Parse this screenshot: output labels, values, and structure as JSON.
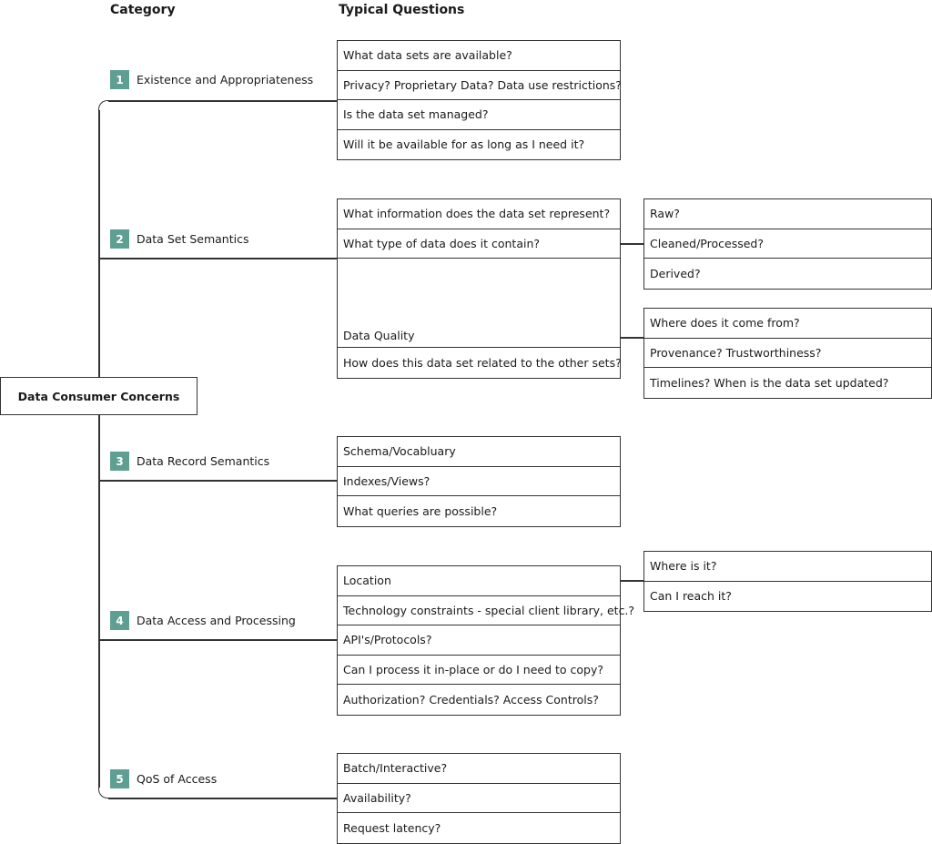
{
  "headers": {
    "category": "Category",
    "questions": "Typical Questions"
  },
  "root": {
    "label": "Data Consumer Concerns"
  },
  "badge_color": "#5f9e92",
  "categories": [
    {
      "number": "1",
      "label": "Existence and Appropriateness",
      "questions": [
        "What data sets are available?",
        "Privacy? Proprietary Data? Data use restrictions?",
        "Is the data set managed?",
        "Will it be available for as long as I need it?"
      ]
    },
    {
      "number": "2",
      "label": "Data Set Semantics",
      "questions": [
        "What information does the data set represent?",
        "What type of data does it contain?",
        "Data Quality",
        "How does this data set related to the other sets?"
      ],
      "subgroups": [
        {
          "parent": "What type of data does it contain?",
          "items": [
            "Raw?",
            "Cleaned/Processed?",
            "Derived?"
          ]
        },
        {
          "parent": "Data Quality",
          "items": [
            "Where does it come from?",
            "Provenance? Trustworthiness?",
            "Timelines? When is the data set updated?"
          ]
        }
      ]
    },
    {
      "number": "3",
      "label": "Data Record Semantics",
      "questions": [
        "Schema/Vocabluary",
        "Indexes/Views?",
        "What queries are possible?"
      ]
    },
    {
      "number": "4",
      "label": "Data Access and Processing",
      "questions": [
        "Location",
        "Technology constraints - special client library, etc.?",
        "API's/Protocols?",
        "Can I process it in-place or do I need to copy?",
        "Authorization? Credentials? Access Controls?"
      ],
      "subgroups": [
        {
          "parent": "Location",
          "items": [
            "Where is it?",
            "Can I reach it?"
          ]
        }
      ]
    },
    {
      "number": "5",
      "label": "QoS of Access",
      "questions": [
        "Batch/Interactive?",
        "Availability?",
        "Request latency?"
      ]
    }
  ]
}
